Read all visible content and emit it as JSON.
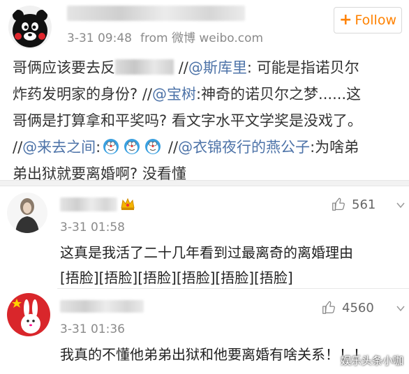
{
  "post": {
    "timestamp": "3-31 09:48",
    "source": "from 微博 weibo.com",
    "follow_label": "Follow",
    "follow_icon": "plus-icon",
    "text": {
      "l1_a": "哥俩应该要去反",
      "l1_b": "//",
      "l1_mention": "@斯库里",
      "l1_c": ": 可能是指诺贝尔",
      "l2_a": "炸药发明家的身份? //",
      "l2_mention": "@宝树",
      "l2_b": ":神奇的诺贝尔之梦......这",
      "l3": "哥俩是打算拿和平奖吗? 看文字水平文学奖是没戏了。",
      "l4_a": "//",
      "l4_mention1": "@来去之间",
      "l4_b": ":",
      "l4_c": " //",
      "l4_mention2": "@衣锦夜行的燕公子",
      "l4_d": ":为啥弟",
      "l5": "弟出狱就要离婚啊? 没看懂"
    }
  },
  "comments": [
    {
      "timestamp": "3-31 01:58",
      "likes": "561",
      "text_line1": "这真是我活了二十几年看到过最离奇的离婚理由",
      "text_line2": "[捂脸][捂脸][捂脸][捂脸][捂脸][捂脸]"
    },
    {
      "timestamp": "3-31 01:36",
      "likes": "4560",
      "text_line1": "我真的不懂他弟弟出狱和他要离婚有啥关系！！！"
    }
  ],
  "watermark": "娱乐头条小咖",
  "colors": {
    "accent": "#ff8200",
    "link": "#4d73a8"
  }
}
